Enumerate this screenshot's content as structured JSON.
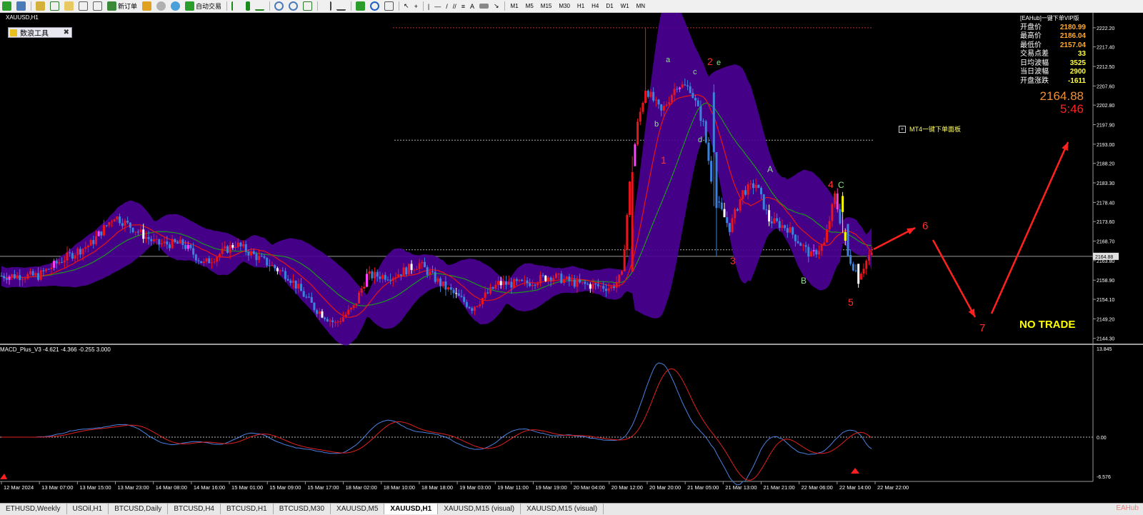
{
  "toolbar": {
    "new_order_label": "新订单",
    "auto_trade_label": "自动交易",
    "timeframes": [
      "M1",
      "M5",
      "M15",
      "M30",
      "H1",
      "H4",
      "D1",
      "W1",
      "MN"
    ]
  },
  "chart": {
    "symbol_label": "XAUUSD,H1",
    "tool_button_label": "数浪工具",
    "current_price_tag": "2164.88",
    "price_axis": [
      "2222.20",
      "2217.40",
      "2212.50",
      "2207.60",
      "2202.80",
      "2197.90",
      "2193.00",
      "2188.20",
      "2183.30",
      "2178.40",
      "2173.60",
      "2168.70",
      "2163.80",
      "2158.90",
      "2154.10",
      "2149.20",
      "2144.30"
    ],
    "time_axis": [
      "12 Mar 2024",
      "13 Mar 07:00",
      "13 Mar 15:00",
      "13 Mar 23:00",
      "14 Mar 08:00",
      "14 Mar 16:00",
      "15 Mar 01:00",
      "15 Mar 09:00",
      "15 Mar 17:00",
      "18 Mar 02:00",
      "18 Mar 10:00",
      "18 Mar 18:00",
      "19 Mar 03:00",
      "19 Mar 11:00",
      "19 Mar 19:00",
      "20 Mar 04:00",
      "20 Mar 12:00",
      "20 Mar 20:00",
      "21 Mar 05:00",
      "21 Mar 13:00",
      "21 Mar 21:00",
      "22 Mar 06:00",
      "22 Mar 14:00",
      "22 Mar 22:00"
    ],
    "wave_labels": {
      "sub": [
        "a",
        "b",
        "c",
        "d",
        "e"
      ],
      "main": [
        "1",
        "2",
        "3",
        "4",
        "5"
      ],
      "corrective": [
        "A",
        "B",
        "C"
      ],
      "projection": [
        "6",
        "7"
      ]
    },
    "no_trade_text": "NO TRADE",
    "mt4_panel_label": "MT4一键下单面板",
    "colors": {
      "bull": "#e8141e",
      "bear": "#3c82dc",
      "band": "#4b0096",
      "ma_red": "#e81414",
      "ma_green": "#1e961e",
      "text_label": "#90e090"
    }
  },
  "info_panel": {
    "title": "[EAHub]一键下单VIP版",
    "rows": [
      {
        "label": "开盘价",
        "value": "2180.99",
        "color": "#ffaa30"
      },
      {
        "label": "最高价",
        "value": "2186.04",
        "color": "#ffaa30"
      },
      {
        "label": "最低价",
        "value": "2157.04",
        "color": "#ffaa30"
      },
      {
        "label": "交易点差",
        "value": "33",
        "color": "#ffff40"
      },
      {
        "label": "日均波幅",
        "value": "3525",
        "color": "#ffff40"
      },
      {
        "label": "当日波幅",
        "value": "2900",
        "color": "#ffff40"
      },
      {
        "label": "开盘涨跌",
        "value": "-1611",
        "color": "#ffff40"
      }
    ],
    "price": "2164.88",
    "countdown": "5:46"
  },
  "macd": {
    "label": "MACD_Plus_V3 -4.621 -4.366 -0.255 3.000",
    "axis": [
      "13.845",
      "0.00",
      "-6.576"
    ]
  },
  "tabs": [
    "ETHUSD,Weekly",
    "USOil,H1",
    "BTCUSD,Daily",
    "BTCUSD,H4",
    "BTCUSD,H1",
    "BTCUSD,M30",
    "XAUUSD,M5",
    "XAUUSD,H1",
    "XAUUSD,M15 (visual)",
    "XAUUSD,M15 (visual)"
  ],
  "active_tab": "XAUUSD,H1",
  "tab_logo": "EAHub"
}
